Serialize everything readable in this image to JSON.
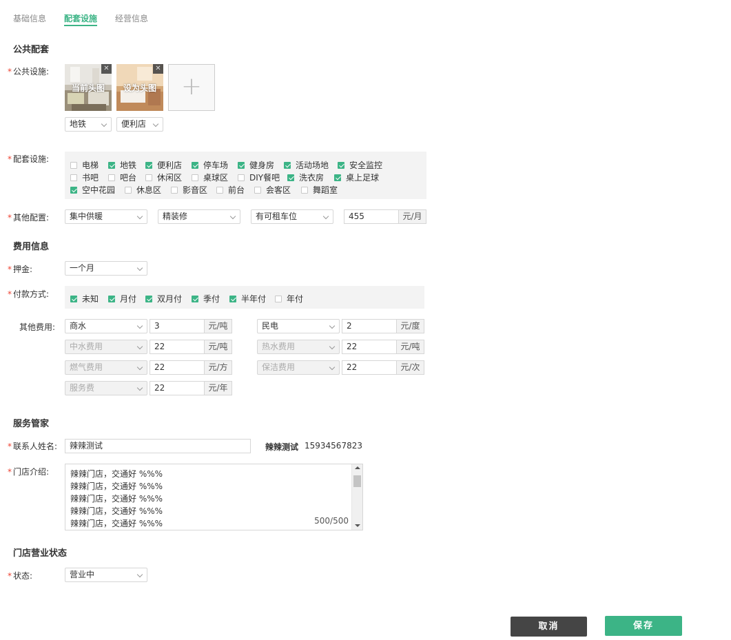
{
  "tabs": [
    "基础信息",
    "配套设施",
    "经营信息"
  ],
  "active_tab": 1,
  "sections": {
    "public": "公共配套",
    "fees": "费用信息",
    "butler": "服务管家",
    "status": "门店营业状态"
  },
  "labels": {
    "public_facilities": "公共设施:",
    "facilities": "配套设施:",
    "other_config": "其他配置:",
    "deposit": "押金:",
    "payment": "付款方式:",
    "other_fees": "其他费用:",
    "contact_name": "联系人姓名:",
    "store_intro": "门店介绍:",
    "status": "状态:"
  },
  "photos": [
    {
      "caption": "当前头图",
      "close": "✕"
    },
    {
      "caption": "设为头图",
      "close": "✕"
    }
  ],
  "add_photo": "+",
  "photo_tags": [
    "地铁",
    "便利店"
  ],
  "facilities": [
    {
      "label": "电梯",
      "checked": false
    },
    {
      "label": "地铁",
      "checked": true
    },
    {
      "label": "便利店",
      "checked": true
    },
    {
      "label": "停车场",
      "checked": true
    },
    {
      "label": "健身房",
      "checked": true
    },
    {
      "label": "活动场地",
      "checked": true
    },
    {
      "label": "安全监控",
      "checked": true
    },
    {
      "label": "书吧",
      "checked": false
    },
    {
      "label": "吧台",
      "checked": false
    },
    {
      "label": "休闲区",
      "checked": false
    },
    {
      "label": "桌球区",
      "checked": false
    },
    {
      "label": "DIY餐吧",
      "checked": false
    },
    {
      "label": "洗衣房",
      "checked": true
    },
    {
      "label": "桌上足球",
      "checked": true
    },
    {
      "label": "空中花园",
      "checked": true
    },
    {
      "label": "休息区",
      "checked": false
    },
    {
      "label": "影音区",
      "checked": false
    },
    {
      "label": "前台",
      "checked": false
    },
    {
      "label": "会客区",
      "checked": false
    },
    {
      "label": "舞蹈室",
      "checked": false
    }
  ],
  "other_config": {
    "heating": "集中供暖",
    "decoration": "精装修",
    "parking": "有可租车位",
    "rent_value": "455",
    "rent_unit": "元/月"
  },
  "deposit": "一个月",
  "payments": [
    {
      "label": "未知",
      "checked": true
    },
    {
      "label": "月付",
      "checked": true
    },
    {
      "label": "双月付",
      "checked": true
    },
    {
      "label": "季付",
      "checked": true
    },
    {
      "label": "半年付",
      "checked": true
    },
    {
      "label": "年付",
      "checked": false
    }
  ],
  "fees": [
    {
      "type": "商水",
      "value": "3",
      "unit": "元/吨",
      "disabled": false
    },
    {
      "type": "民电",
      "value": "2",
      "unit": "元/度",
      "disabled": false
    },
    {
      "type": "中水费用",
      "value": "22",
      "unit": "元/吨",
      "disabled": true
    },
    {
      "type": "热水费用",
      "value": "22",
      "unit": "元/吨",
      "disabled": true
    },
    {
      "type": "燃气费用",
      "value": "22",
      "unit": "元/方",
      "disabled": true
    },
    {
      "type": "保洁费用",
      "value": "22",
      "unit": "元/次",
      "disabled": true
    },
    {
      "type": "服务费",
      "value": "22",
      "unit": "元/年",
      "disabled": true
    }
  ],
  "contact": {
    "name_value": "辣辣测试",
    "display_name": "辣辣测试",
    "phone": "15934567823"
  },
  "intro": {
    "lines": [
      "辣辣门店，交通好 %%%",
      "辣辣门店，交通好 %%%",
      "辣辣门店，交通好 %%%",
      "辣辣门店，交通好 %%%",
      "辣辣门店，交通好 %%%"
    ],
    "counter": "500/500"
  },
  "status_value": "营业中",
  "buttons": {
    "cancel": "取消",
    "save": "保存"
  },
  "colors": {
    "accent": "#3cb486",
    "dark_button": "#454545",
    "required": "#e43"
  }
}
